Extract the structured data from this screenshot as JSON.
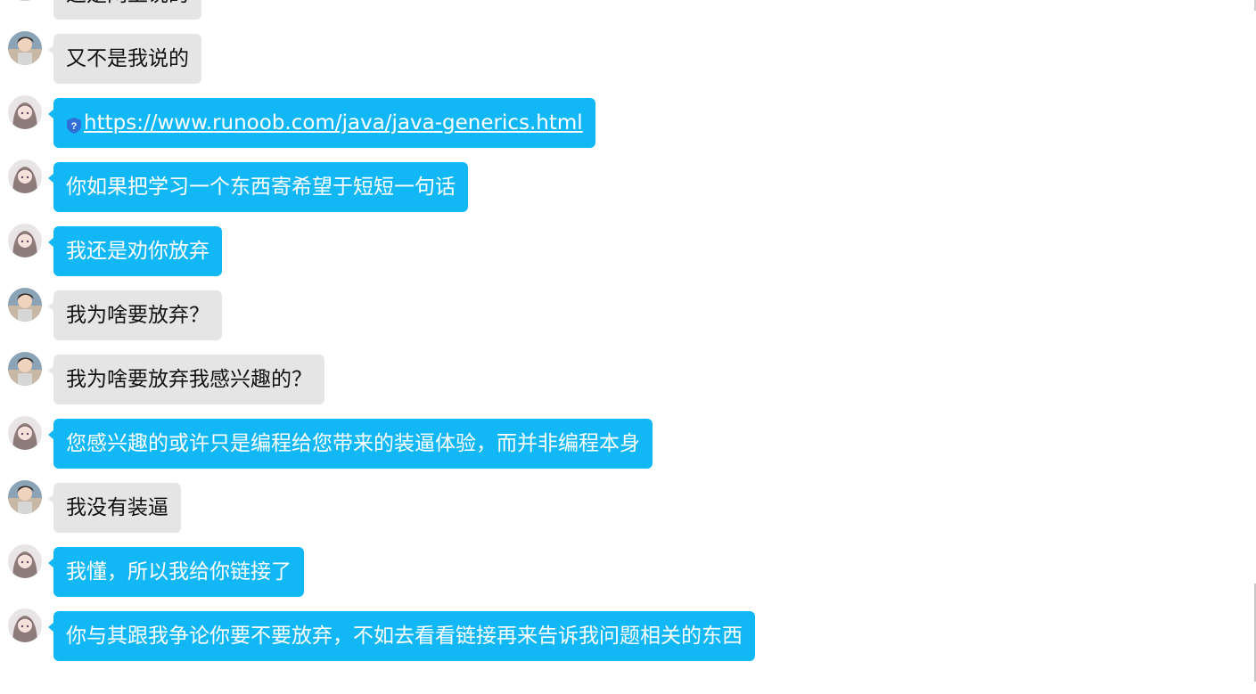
{
  "window": {
    "colors": {
      "incoming_bubble": "#e5e5e5",
      "outgoing_bubble": "#12b7f5",
      "incoming_text": "#111111",
      "outgoing_text": "#ffffff"
    }
  },
  "messages": [
    {
      "sender": "boy",
      "style": "gray",
      "text": "这是网上说的"
    },
    {
      "sender": "boy",
      "style": "gray",
      "text": "又不是我说的"
    },
    {
      "sender": "girl",
      "style": "blue",
      "text": "https://www.runoob.com/java/java-generics.html",
      "is_link": true,
      "icon": "shield-question-icon"
    },
    {
      "sender": "girl",
      "style": "blue",
      "text": "你如果把学习一个东西寄希望于短短一句话"
    },
    {
      "sender": "girl",
      "style": "blue",
      "text": "我还是劝你放弃"
    },
    {
      "sender": "boy",
      "style": "gray",
      "text": "我为啥要放弃？"
    },
    {
      "sender": "boy",
      "style": "gray",
      "text": "我为啥要放弃我感兴趣的？"
    },
    {
      "sender": "girl",
      "style": "blue",
      "text": "您感兴趣的或许只是编程给您带来的装逼体验，而并非编程本身"
    },
    {
      "sender": "boy",
      "style": "gray",
      "text": "我没有装逼"
    },
    {
      "sender": "girl",
      "style": "blue",
      "text": "我懂，所以我给你链接了"
    },
    {
      "sender": "girl",
      "style": "blue",
      "text": "你与其跟我争论你要不要放弃，不如去看看链接再来告诉我问题相关的东西"
    }
  ],
  "avatars": {
    "boy": "avatar-boy-icon",
    "girl": "avatar-girl-icon"
  }
}
